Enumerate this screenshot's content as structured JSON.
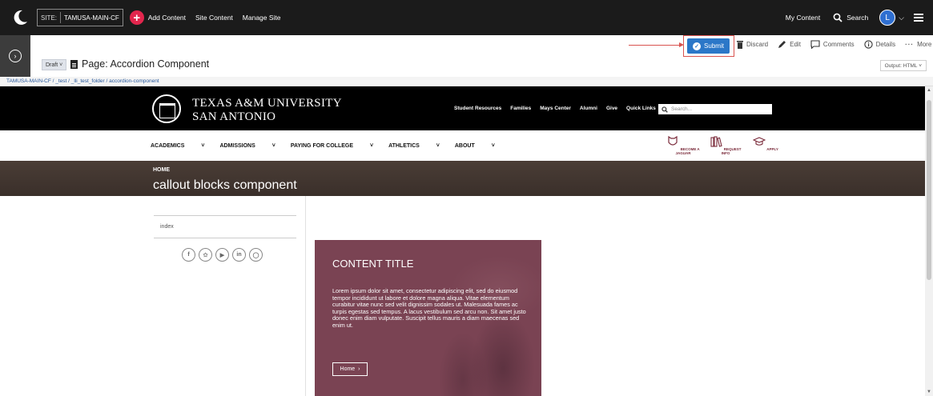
{
  "topbar": {
    "site_label": "SITE:",
    "site_name": "TAMUSA-MAIN-CF",
    "add_content": "Add Content",
    "site_content": "Site Content",
    "manage_site": "Manage Site",
    "my_content": "My Content",
    "search": "Search",
    "avatar_letter": "L"
  },
  "page": {
    "status": "Draft",
    "title": "Page: Accordion Component",
    "actions": {
      "submit": "Submit",
      "discard": "Discard",
      "edit": "Edit",
      "comments": "Comments",
      "details": "Details",
      "more": "More"
    },
    "output": "Output: HTML"
  },
  "breadcrumb": "TAMUSA-MAIN-CF / _test / _lli_test_folder / accordion-component",
  "preview": {
    "univ_line1": "TEXAS A&M UNIVERSITY",
    "univ_line2": "SAN ANTONIO",
    "utility_nav": [
      "Student Resources",
      "Families",
      "Mays Center",
      "Alumni",
      "Give",
      "Quick Links"
    ],
    "search_placeholder": "Search...",
    "main_nav": [
      "ACADEMICS",
      "ADMISSIONS",
      "PAYING FOR COLLEGE",
      "ATHLETICS",
      "ABOUT"
    ],
    "quick_links": [
      "BECOME A JAGUAR",
      "REQUEST INFO",
      "APPLY"
    ],
    "hero_home": "HOME",
    "hero_title": "callout blocks component",
    "side_index": "index",
    "callout": {
      "title": "CONTENT TITLE",
      "body": "Lorem ipsum dolor sit amet, consectetur adipiscing elit, sed do eiusmod tempor incididunt ut labore et dolore magna aliqua. Vitae elementum curabitur vitae nunc sed velit dignissim sodales ut. Malesuada fames ac turpis egestas sed tempus. A lacus vestibulum sed arcu non. Sit amet justo donec enim diam vulputate. Suscipit tellus mauris a diam maecenas sed enim ut.",
      "button": "Home"
    }
  },
  "colors": {
    "cms_dark": "#1b1b1b",
    "submit_blue": "#2b77c8",
    "highlight_red": "#d9534f",
    "maroon": "#7a4353"
  }
}
